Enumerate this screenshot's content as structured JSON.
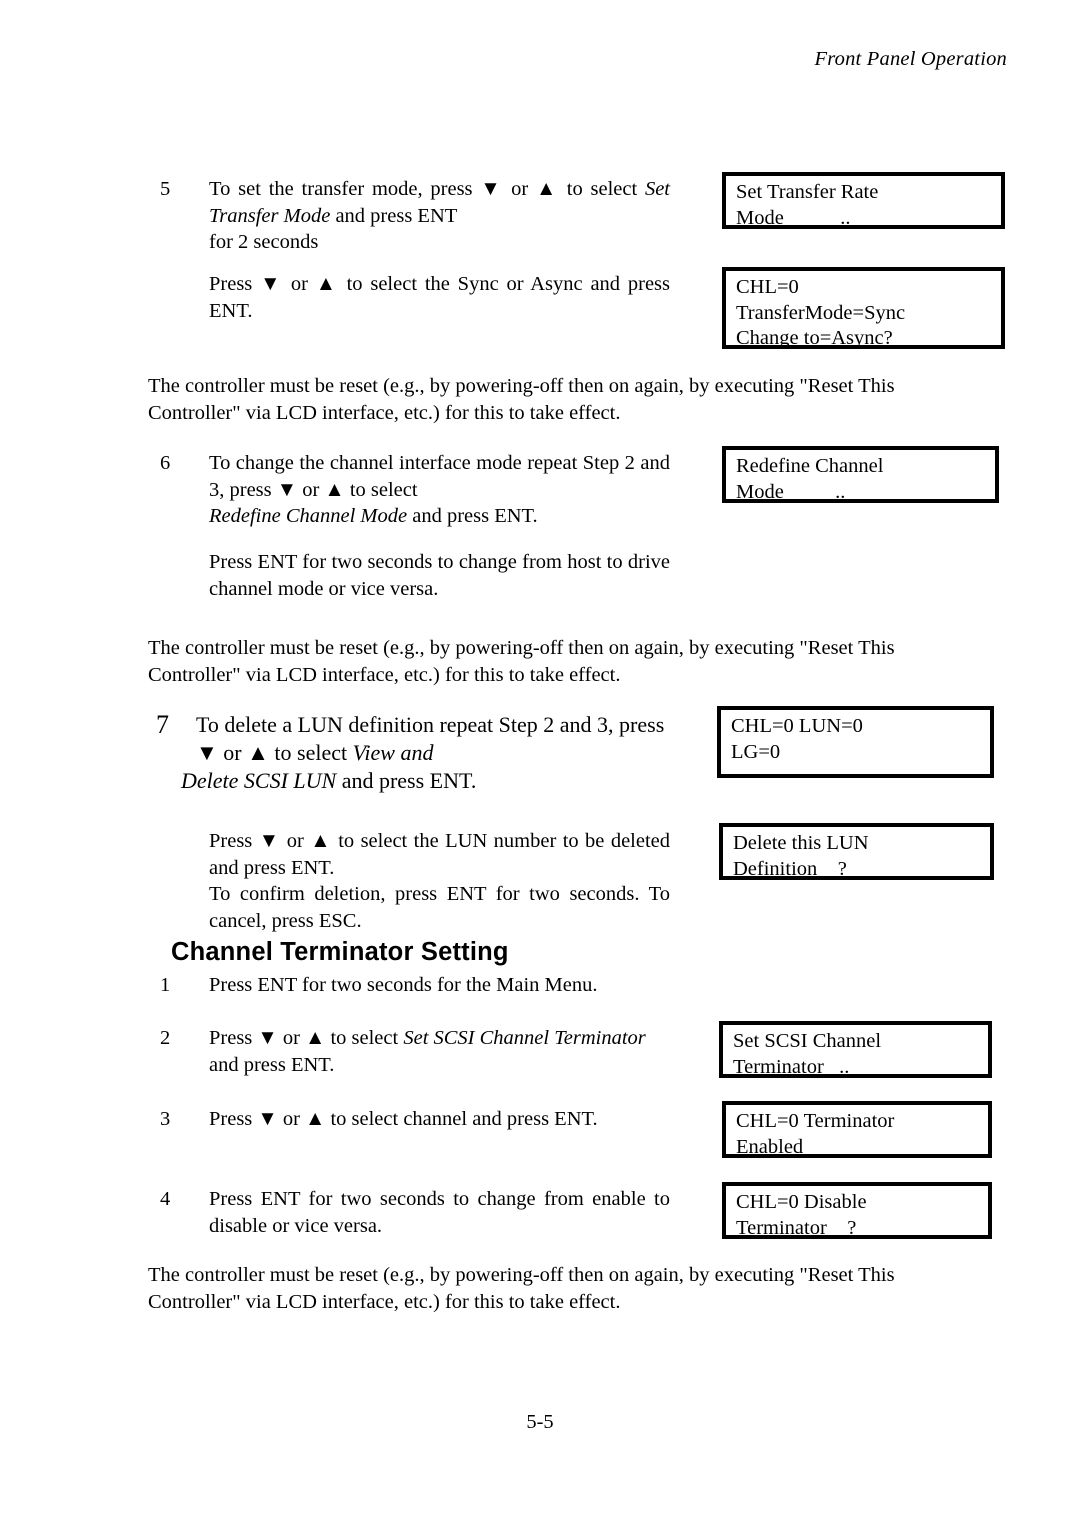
{
  "header": {
    "running_title": "Front Panel Operation"
  },
  "steps": {
    "s5": {
      "number": "5",
      "line1_a": "To set the transfer mode, press ",
      "down_arrow": "▼",
      "line1_b": " or ",
      "up_arrow": "▲",
      "line1_c": " to select ",
      "italic1": "Set Transfer Mode",
      "line1_d": " and press ENT",
      "line2": "for 2 seconds",
      "sub_a": "Press ",
      "sub_b": " or ",
      "sub_c": " to select the Sync or Async and press ENT."
    },
    "s6": {
      "number": "6",
      "line1_a": "To change the channel interface mode repeat Step 2 and 3, press ",
      "line1_b": " or ",
      "line1_c": " to select",
      "italic1": "Redefine Channel Mode",
      "line2_b": " and press ENT.",
      "sub": "Press ENT for two seconds to change from host to drive channel mode or vice versa."
    },
    "s7": {
      "number": "7",
      "line1_a": "To delete a LUN definition repeat Step 2 and 3, press",
      "line2_a": " or ",
      "line2_b": " to select ",
      "italic1": "View and",
      "italic2": "Delete SCSI LUN",
      "line3_b": " and press ENT.",
      "sub1_a": "Press ",
      "sub1_b": " or ",
      "sub1_c": " to select the LUN number to be deleted and press ENT.",
      "sub2": "To confirm deletion, press ENT for two seconds.  To cancel, press ESC."
    },
    "t1": {
      "number": "1",
      "text": "Press ENT for two seconds for the Main Menu."
    },
    "t2": {
      "number": "2",
      "line1_a": "Press ",
      "line1_b": " or ",
      "line1_c": " to select ",
      "italic1": "Set SCSI Channel Terminator",
      "line2": "and press ENT."
    },
    "t3": {
      "number": "3",
      "line1_a": "Press ",
      "line1_b": " or ",
      "line1_c": " to select channel and press ENT."
    },
    "t4": {
      "number": "4",
      "text": "Press ENT for two seconds to change from enable to disable or vice versa."
    }
  },
  "notes": {
    "note1": "The controller must be reset (e.g., by powering-off then on again, by executing \"Reset This Controller\" via LCD interface, etc.) for this to take effect.",
    "note2": "The controller must be reset (e.g., by powering-off then on again, by executing \"Reset This Controller\" via LCD interface, etc.) for this to take effect.",
    "note3": "The controller must be reset (e.g., by powering-off then on again, by executing \"Reset This Controller\" via LCD interface, etc.) for this to take effect."
  },
  "headings": {
    "channel_terminator_setting": "Channel  Terminator Setting"
  },
  "lcd_panels": [
    {
      "id": "set-transfer-rate-mode",
      "lines": [
        "Set Transfer Rate",
        "Mode           .."
      ]
    },
    {
      "id": "transfer-mode-change",
      "lines": [
        "CHL=0",
        "TransferMode=Sync",
        "Change to=Async?"
      ]
    },
    {
      "id": "redefine-channel-mode",
      "lines": [
        "Redefine Channel",
        "Mode          .."
      ]
    },
    {
      "id": "chl-lun-lg",
      "lines": [
        "CHL=0 LUN=0",
        "LG=0"
      ]
    },
    {
      "id": "delete-this-lun-definition",
      "lines": [
        "Delete this LUN",
        "Definition    ?"
      ]
    },
    {
      "id": "set-scsi-channel-terminator",
      "lines": [
        "Set SCSI Channel",
        "Terminator   .."
      ]
    },
    {
      "id": "chl-terminator-enabled",
      "lines": [
        "CHL=0 Terminator",
        "Enabled"
      ]
    },
    {
      "id": "chl-disable-terminator",
      "lines": [
        "CHL=0 Disable",
        "Terminator    ?"
      ]
    }
  ],
  "footer": {
    "page_number": "5-5"
  }
}
